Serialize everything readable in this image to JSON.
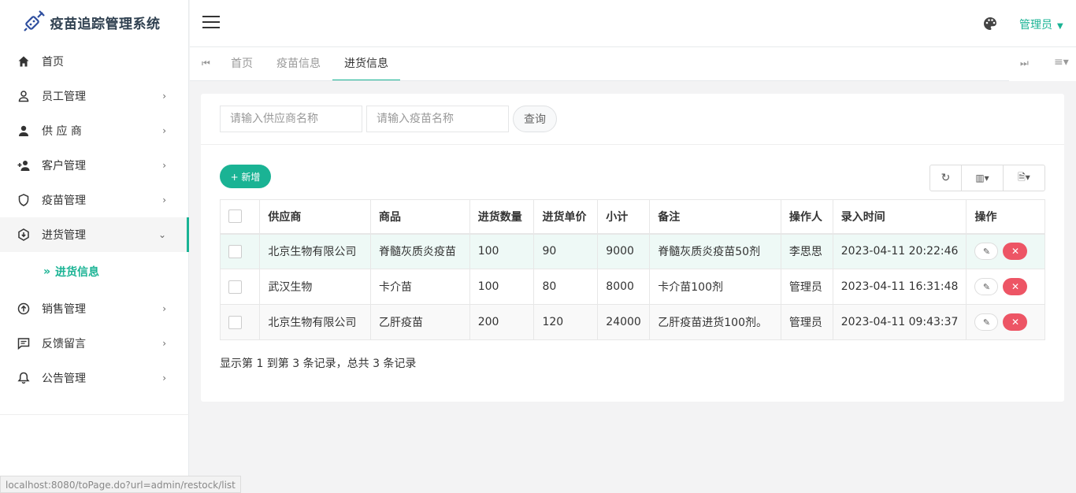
{
  "app": {
    "title": "疫苗追踪管理系统"
  },
  "sidebar": {
    "items": [
      {
        "label": "首页",
        "icon": "home-icon",
        "has_arrow": false
      },
      {
        "label": "员工管理",
        "icon": "user-outline-icon",
        "has_arrow": true,
        "arrow": "›"
      },
      {
        "label": "供 应 商",
        "icon": "user-icon",
        "has_arrow": true,
        "arrow": "›"
      },
      {
        "label": "客户管理",
        "icon": "user-add-icon",
        "has_arrow": true,
        "arrow": "›"
      },
      {
        "label": "疫苗管理",
        "icon": "shield-icon",
        "has_arrow": true,
        "arrow": "›"
      },
      {
        "label": "进货管理",
        "icon": "box-icon",
        "has_arrow": true,
        "arrow": "⌄",
        "active": true
      },
      {
        "label": "销售管理",
        "icon": "upload-circle-icon",
        "has_arrow": true,
        "arrow": "›"
      },
      {
        "label": "反馈留言",
        "icon": "message-icon",
        "has_arrow": true,
        "arrow": "›"
      },
      {
        "label": "公告管理",
        "icon": "bell-icon",
        "has_arrow": true,
        "arrow": "›"
      }
    ],
    "submenu": {
      "prefix": "»",
      "label": "进货信息"
    }
  },
  "header": {
    "user_label": "管理员",
    "caret": "▼"
  },
  "tabs": {
    "items": [
      "首页",
      "疫苗信息",
      "进货信息"
    ],
    "active_index": 2,
    "prev_icon": "⏮",
    "next_icon": "⏭",
    "menu_icon": "≡▾"
  },
  "search": {
    "supplier_placeholder": "请输入供应商名称",
    "vaccine_placeholder": "请输入疫苗名称",
    "query_label": "查询"
  },
  "toolbar": {
    "add_label": "+ 新增",
    "refresh_icon": "↻",
    "columns_icon": "▥▾",
    "export_icon": "🗎▾"
  },
  "table": {
    "headers": [
      "供应商",
      "商品",
      "进货数量",
      "进货单价",
      "小计",
      "备注",
      "操作人",
      "录入时间",
      "操作"
    ],
    "rows": [
      [
        "北京生物有限公司",
        "脊髓灰质炎疫苗",
        "100",
        "90",
        "9000",
        "脊髓灰质炎疫苗50剂",
        "李思思",
        "2023-04-11 20:22:46"
      ],
      [
        "武汉生物",
        "卡介苗",
        "100",
        "80",
        "8000",
        "卡介苗100剂",
        "管理员",
        "2023-04-11 16:31:48"
      ],
      [
        "北京生物有限公司",
        "乙肝疫苗",
        "200",
        "120",
        "24000",
        "乙肝疫苗进货100剂。",
        "管理员",
        "2023-04-11 09:43:37"
      ]
    ],
    "edit_icon": "✎",
    "delete_icon": "✕"
  },
  "summary": "显示第 1 到第 3 条记录，总共 3 条记录",
  "statusbar": "localhost:8080/toPage.do?url=admin/restock/list",
  "colors": {
    "accent": "#1ab394",
    "danger": "#ed5565"
  }
}
